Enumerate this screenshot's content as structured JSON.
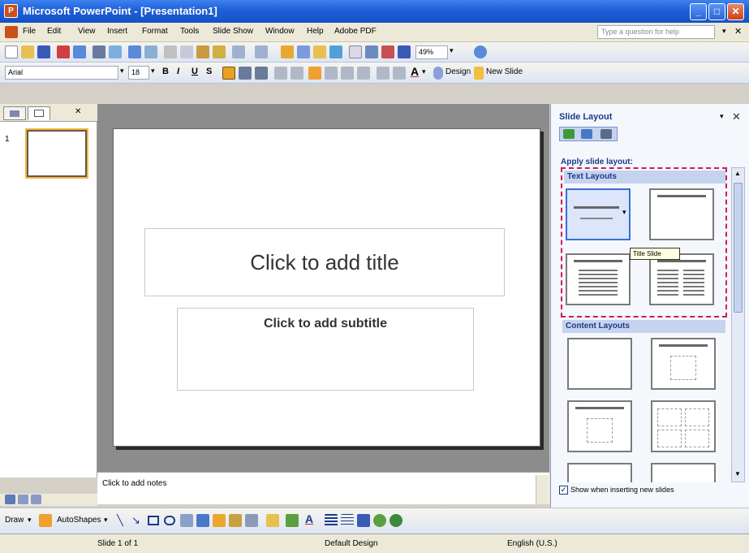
{
  "window": {
    "title": "Microsoft PowerPoint - [Presentation1]",
    "min_glyph": "_",
    "max_glyph": "□",
    "close_glyph": "✕"
  },
  "menu": {
    "items": [
      "File",
      "Edit",
      "View",
      "Insert",
      "Format",
      "Tools",
      "Slide Show",
      "Window",
      "Help",
      "Adobe PDF"
    ],
    "help_placeholder": "Type a question for help",
    "close_doc_glyph": "✕"
  },
  "toolbar": {
    "zoom": "49%",
    "font_name": "Arial",
    "font_size": "18",
    "bold": "B",
    "italic": "I",
    "underline": "U",
    "shadow": "S",
    "font_color_glyph": "A",
    "design_label": "Design",
    "new_slide_label": "New Slide"
  },
  "outline_pane": {
    "slide_number": "1",
    "close_glyph": "✕"
  },
  "slide": {
    "title_placeholder": "Click to add title",
    "subtitle_placeholder": "Click to add subtitle"
  },
  "notes": {
    "placeholder": "Click to add notes"
  },
  "task_pane": {
    "title": "Slide Layout",
    "close_glyph": "✕",
    "apply_label": "Apply slide layout:",
    "text_layouts_header": "Text Layouts",
    "content_layouts_header": "Content Layouts",
    "tooltip": "Title Slide",
    "show_when_inserting": "Show when inserting new slides",
    "checkbox_glyph": "✓"
  },
  "draw_toolbar": {
    "draw_label": "Draw",
    "autoshapes_label": "AutoShapes"
  },
  "status": {
    "slide_info": "Slide 1 of 1",
    "design": "Default Design",
    "language": "English (U.S.)"
  },
  "colors": {
    "title_bar": "#1f5fd8",
    "selection_outline": "#d01a5a",
    "task_pane_accent": "#1a3a8a"
  }
}
